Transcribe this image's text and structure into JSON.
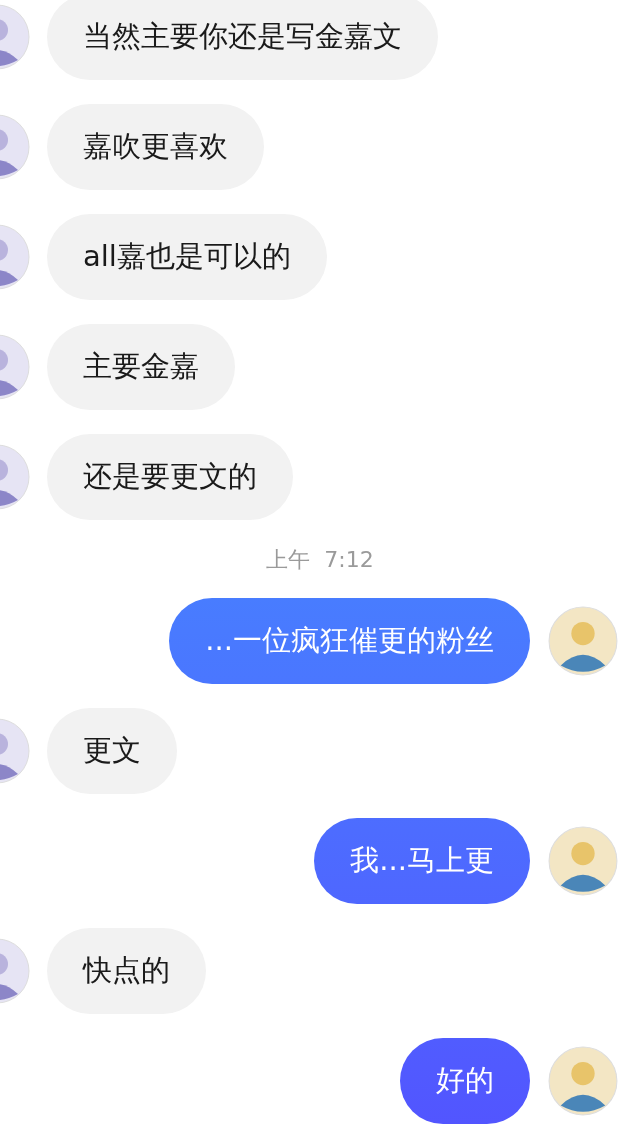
{
  "messages": [
    {
      "kind": "received",
      "text": "当然主要你还是写金嘉文"
    },
    {
      "kind": "received",
      "text": "嘉吹更喜欢"
    },
    {
      "kind": "received",
      "text": "all嘉也是可以的"
    },
    {
      "kind": "received",
      "text": "主要金嘉"
    },
    {
      "kind": "received",
      "text": "还是要更文的"
    },
    {
      "kind": "time",
      "text": "上午  7:12"
    },
    {
      "kind": "sent",
      "text": "...一位疯狂催更的粉丝"
    },
    {
      "kind": "received",
      "text": "更文"
    },
    {
      "kind": "sent",
      "text": "我...马上更"
    },
    {
      "kind": "received",
      "text": "快点的"
    },
    {
      "kind": "sent",
      "text": "好的"
    }
  ]
}
